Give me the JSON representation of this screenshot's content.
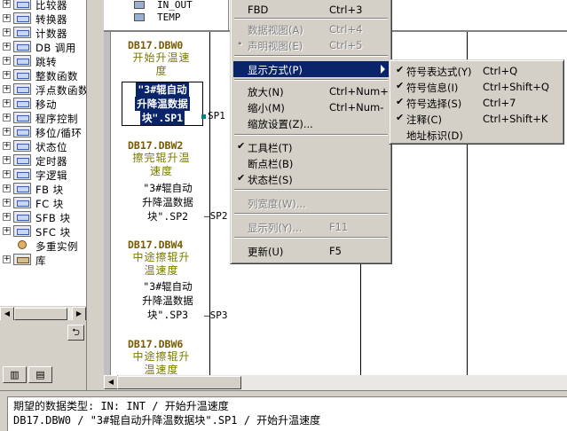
{
  "tree": {
    "items": [
      {
        "label": "比较器",
        "expander": "+",
        "icon": "block-icon"
      },
      {
        "label": "转换器",
        "expander": "+",
        "icon": "block-icon"
      },
      {
        "label": "计数器",
        "expander": "+",
        "icon": "block-icon"
      },
      {
        "label": "DB 调用",
        "expander": "+",
        "icon": "block-icon"
      },
      {
        "label": "跳转",
        "expander": "+",
        "icon": "block-icon"
      },
      {
        "label": "整数函数",
        "expander": "+",
        "icon": "block-icon"
      },
      {
        "label": "浮点数函数",
        "expander": "+",
        "icon": "block-icon"
      },
      {
        "label": "移动",
        "expander": "+",
        "icon": "block-icon"
      },
      {
        "label": "程序控制",
        "expander": "+",
        "icon": "block-icon"
      },
      {
        "label": "移位/循环",
        "expander": "+",
        "icon": "block-icon"
      },
      {
        "label": "状态位",
        "expander": "+",
        "icon": "block-icon"
      },
      {
        "label": "定时器",
        "expander": "+",
        "icon": "block-icon"
      },
      {
        "label": "字逻辑",
        "expander": "+",
        "icon": "block-icon"
      },
      {
        "label": "FB 块",
        "expander": "+",
        "icon": "block-icon"
      },
      {
        "label": "FC 块",
        "expander": "+",
        "icon": "block-icon"
      },
      {
        "label": "SFB 块",
        "expander": "+",
        "icon": "block-icon"
      },
      {
        "label": "SFC 块",
        "expander": "+",
        "icon": "block-icon"
      },
      {
        "label": "多重实例",
        "expander": "",
        "icon": "multi-instance-icon"
      },
      {
        "label": "库",
        "expander": "+",
        "icon": "library-icon"
      }
    ]
  },
  "varpane": {
    "rows": [
      {
        "name": "IN_OUT"
      },
      {
        "name": "TEMP"
      }
    ]
  },
  "networks": [
    {
      "addr": "DB17.DBW0",
      "comment": "开始升温速度",
      "symbol": "\"3#辊自动升降温数据块\".SP1",
      "pin": "SP1",
      "selected": true
    },
    {
      "addr": "DB17.DBW2",
      "comment": "擦完辊升温速度",
      "symbol": "\"3#辊自动升降温数据块\".SP2",
      "pin": "SP2",
      "selected": false
    },
    {
      "addr": "DB17.DBW4",
      "comment": "中途擦辊升温速度",
      "symbol": "\"3#辊自动升降温数据块\".SP3",
      "pin": "SP3",
      "selected": false
    },
    {
      "addr": "DB17.DBW6",
      "comment": "中途擦辊升",
      "symbol": "",
      "pin": "",
      "selected": false
    }
  ],
  "network_text": {
    "n1_comment_lines": [
      "开始升温速",
      "度"
    ],
    "n1_symbol_lines": [
      "\"3#辊自动",
      "升降温数据",
      "块\".SP1"
    ],
    "n2_comment_lines": [
      "擦完辊升温",
      "速度"
    ],
    "n2_symbol_lines": [
      "\"3#辊自动",
      "升降温数据",
      "块\".SP2"
    ],
    "n3_comment_lines": [
      "中途擦辊升",
      "温速度"
    ],
    "n3_symbol_lines": [
      "\"3#辊自动",
      "升降温数据",
      "块\".SP3"
    ],
    "n4_comment_lines": [
      "中途擦辊升",
      "温速度"
    ]
  },
  "context_menu": {
    "items": [
      {
        "label": "FBD",
        "accel": "Ctrl+3",
        "disabled": false,
        "check": ""
      },
      {
        "label": "数据视图(A)",
        "accel": "Ctrl+4",
        "disabled": true,
        "check": ""
      },
      {
        "label": "声明视图(E)",
        "accel": "Ctrl+5",
        "disabled": true,
        "check": "•"
      },
      {
        "label": "显示方式(P)",
        "accel": "",
        "disabled": false,
        "check": "",
        "highlight": true
      },
      {
        "label": "放大(N)",
        "accel": "Ctrl+Num+",
        "disabled": false,
        "check": ""
      },
      {
        "label": "缩小(M)",
        "accel": "Ctrl+Num-",
        "disabled": false,
        "check": ""
      },
      {
        "label": "缩放设置(Z)...",
        "accel": "",
        "disabled": false,
        "check": ""
      },
      {
        "label": "工具栏(T)",
        "accel": "",
        "disabled": false,
        "check": "✔"
      },
      {
        "label": "断点栏(B)",
        "accel": "",
        "disabled": false,
        "check": ""
      },
      {
        "label": "状态栏(S)",
        "accel": "",
        "disabled": false,
        "check": "✔"
      },
      {
        "label": "列宽度(W)...",
        "accel": "",
        "disabled": true,
        "check": ""
      },
      {
        "label": "显示列(Y)...",
        "accel": "F11",
        "disabled": true,
        "check": ""
      },
      {
        "label": "更新(U)",
        "accel": "F5",
        "disabled": false,
        "check": ""
      }
    ]
  },
  "submenu": {
    "items": [
      {
        "label": "符号表达式(Y)",
        "accel": "Ctrl+Q",
        "check": "✔"
      },
      {
        "label": "符号信息(I)",
        "accel": "Ctrl+Shift+Q",
        "check": "✔"
      },
      {
        "label": "符号选择(S)",
        "accel": "Ctrl+7",
        "check": "✔"
      },
      {
        "label": "注释(C)",
        "accel": "Ctrl+Shift+K",
        "check": "✔"
      },
      {
        "label": "地址标识(D)",
        "accel": "",
        "check": ""
      }
    ]
  },
  "status": {
    "line1": "期望的数据类型: IN: INT / 开始升温速度",
    "line2": "DB17.DBW0 / \"3#辊自动升降温数据块\".SP1 / 开始升温速度"
  },
  "tabs": [
    {
      "icon": "program-elements-tab-icon"
    },
    {
      "icon": "call-structure-tab-icon"
    }
  ],
  "colors": {
    "selection": "#0a246a",
    "address_text": "#7a5a00",
    "comment_text": "#7a7a00",
    "pin_marker": "#008080"
  }
}
